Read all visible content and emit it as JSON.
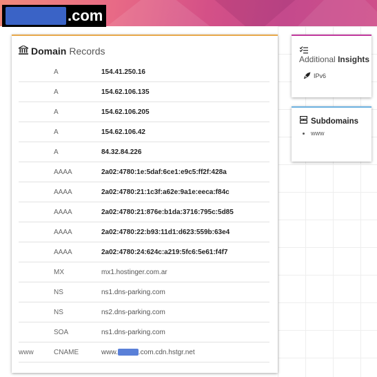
{
  "header": {
    "domain_tld": ".com"
  },
  "records_card": {
    "title_bold": "Domain",
    "title_light": "Records",
    "rows": [
      {
        "host": "",
        "type": "A",
        "value": "154.41.250.16",
        "bold": true
      },
      {
        "host": "",
        "type": "A",
        "value": "154.62.106.135",
        "bold": true
      },
      {
        "host": "",
        "type": "A",
        "value": "154.62.106.205",
        "bold": true
      },
      {
        "host": "",
        "type": "A",
        "value": "154.62.106.42",
        "bold": true
      },
      {
        "host": "",
        "type": "A",
        "value": "84.32.84.226",
        "bold": true
      },
      {
        "host": "",
        "type": "AAAA",
        "value": "2a02:4780:1e:5daf:6ce1:e9c5:ff2f:428a",
        "bold": true
      },
      {
        "host": "",
        "type": "AAAA",
        "value": "2a02:4780:21:1c3f:a62e:9a1e:eeca:f84c",
        "bold": true
      },
      {
        "host": "",
        "type": "AAAA",
        "value": "2a02:4780:21:876e:b1da:3716:795c:5d85",
        "bold": true
      },
      {
        "host": "",
        "type": "AAAA",
        "value": "2a02:4780:22:b93:11d1:d623:559b:63e4",
        "bold": true
      },
      {
        "host": "",
        "type": "AAAA",
        "value": "2a02:4780:24:624c:a219:5fc6:5e61:f4f7",
        "bold": true
      },
      {
        "host": "",
        "type": "MX",
        "value": "mx1.hostinger.com.ar",
        "bold": false
      },
      {
        "host": "",
        "type": "NS",
        "value": "ns1.dns-parking.com",
        "bold": false
      },
      {
        "host": "",
        "type": "NS",
        "value": "ns2.dns-parking.com",
        "bold": false
      },
      {
        "host": "",
        "type": "SOA",
        "value": "ns1.dns-parking.com",
        "bold": false
      }
    ],
    "cname_row": {
      "host": "www",
      "type": "CNAME",
      "value_prefix": "www.",
      "value_suffix": ".com.cdn.hstgr.net"
    }
  },
  "insights_card": {
    "title_light": "Additional",
    "title_bold": "Insights",
    "item": "IPv6"
  },
  "subdomains_card": {
    "title": "Subdomains",
    "items": [
      "www"
    ]
  },
  "colors": {
    "records_accent": "#e8a84a",
    "insights_accent": "#c0389c",
    "subdomains_accent": "#6cb1e0",
    "redaction": "#3a63c6"
  },
  "icons": {
    "records_title": "bank-icon",
    "insights_title": "checklist-icon",
    "insights_item": "rocket-icon",
    "subdomains_title": "server-icon"
  }
}
